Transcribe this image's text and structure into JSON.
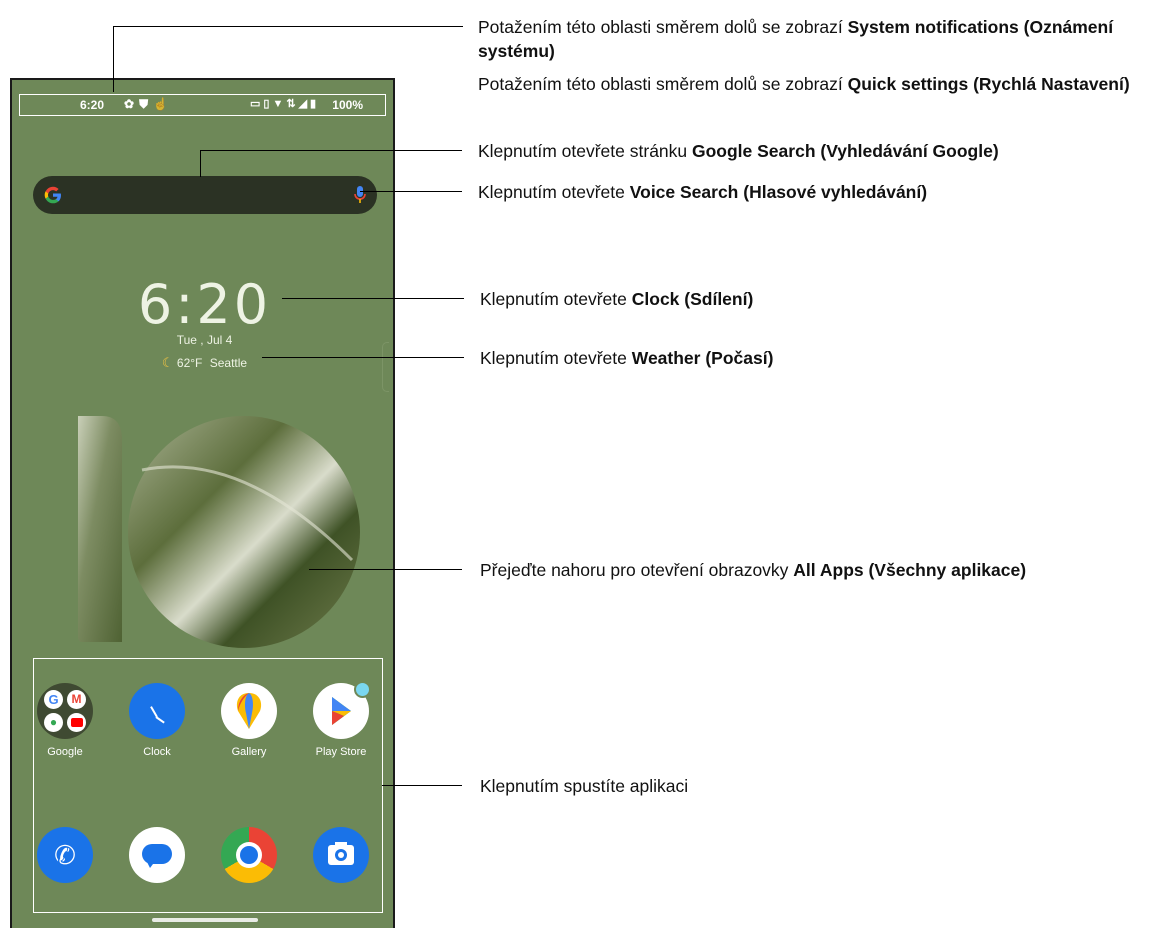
{
  "status_bar": {
    "time": "6:20",
    "battery": "100%"
  },
  "clock_widget": {
    "time": "6:20",
    "date": "Tue , Jul 4"
  },
  "weather_widget": {
    "temperature": "62°F",
    "city": "Seattle"
  },
  "apps": [
    {
      "label": "Google",
      "icon": "google-folder-icon"
    },
    {
      "label": "Clock",
      "icon": "clock-icon"
    },
    {
      "label": "Gallery",
      "icon": "gallery-icon"
    },
    {
      "label": "Play Store",
      "icon": "play-store-icon"
    }
  ],
  "dock": [
    {
      "icon": "phone-icon"
    },
    {
      "icon": "messages-icon"
    },
    {
      "icon": "chrome-icon"
    },
    {
      "icon": "camera-icon"
    }
  ],
  "annotations": {
    "system_notifications": {
      "text": "Potažením této oblasti směrem dolů se zobrazí ",
      "bold": "System notifications (Oznámení systému)"
    },
    "quick_settings": {
      "text": "Potažením této oblasti směrem dolů se zobrazí ",
      "bold": "Quick settings (Rychlá Nastavení)"
    },
    "google_search": {
      "text": "Klepnutím otevřete stránku ",
      "bold": "Google Search (Vyhledávání Google)"
    },
    "voice_search": {
      "text": "Klepnutím otevřete ",
      "bold": "Voice Search (Hlasové vyhledávání)"
    },
    "clock": {
      "text": "Klepnutím otevřete ",
      "bold": "Clock (Sdílení)"
    },
    "weather": {
      "text": "Klepnutím otevřete ",
      "bold": "Weather (Počasí)"
    },
    "all_apps": {
      "text": "Přejeďte nahoru pro otevření obrazovky ",
      "bold": "All Apps (Všechny aplikace)"
    },
    "launch_app": {
      "text": "Klepnutím spustíte aplikaci"
    }
  },
  "colors": {
    "wallpaper": "#6e8858",
    "search_bar": "#2b3224",
    "clock_app": "#1a73e8"
  }
}
